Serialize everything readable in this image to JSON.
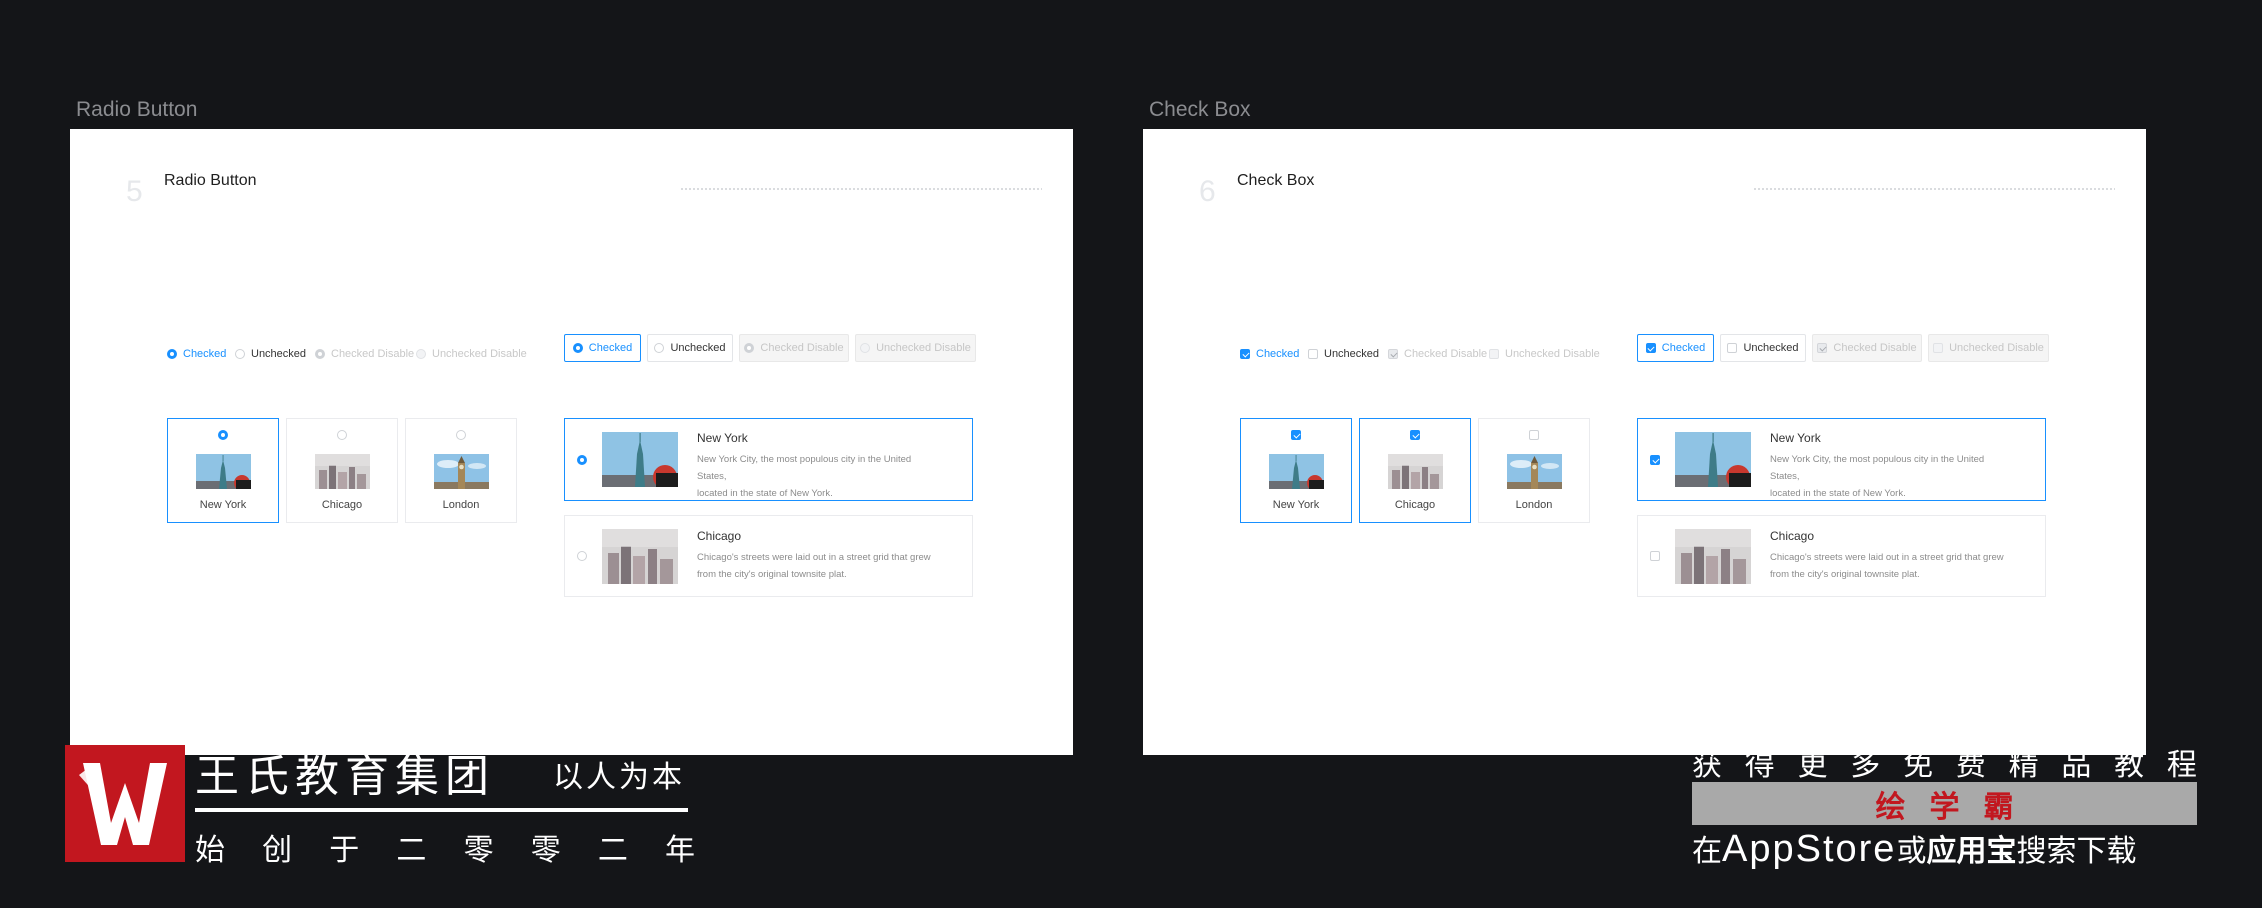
{
  "frames": [
    {
      "label": "Radio Button",
      "number": "5",
      "title": "Radio Button"
    },
    {
      "label": "Check Box",
      "number": "6",
      "title": "Check Box"
    }
  ],
  "options": [
    "Checked",
    "Unchecked",
    "Checked Disable",
    "Unchecked Disable"
  ],
  "cities": [
    "New York",
    "Chicago",
    "London"
  ],
  "list": {
    "new_york": {
      "title": "New York",
      "desc1": "New York City, the most populous city in the United",
      "desc2": "States,",
      "desc3": "located in the state of New York."
    },
    "chicago": {
      "title": "Chicago",
      "desc1": "Chicago's streets were laid out in a street grid that grew",
      "desc2": "from the city's original townsite plat."
    }
  },
  "footer": {
    "brand": "王氏教育集团",
    "motto": "以人为本",
    "founded": [
      "始",
      "创",
      "于",
      "二",
      "零",
      "零",
      "二",
      "年"
    ],
    "promo_line1": [
      "获",
      "得",
      "更",
      "多",
      "免",
      "费",
      "精",
      "品",
      "教",
      "程"
    ],
    "promo_band": "绘学霸",
    "promo_pre": "在",
    "promo_store1": "AppStore",
    "promo_mid": "或",
    "promo_store2": "应用宝",
    "promo_post": "搜索下载"
  },
  "colors": {
    "accent": "#1890ff",
    "brand_red": "#c2171f",
    "background": "#141518"
  }
}
